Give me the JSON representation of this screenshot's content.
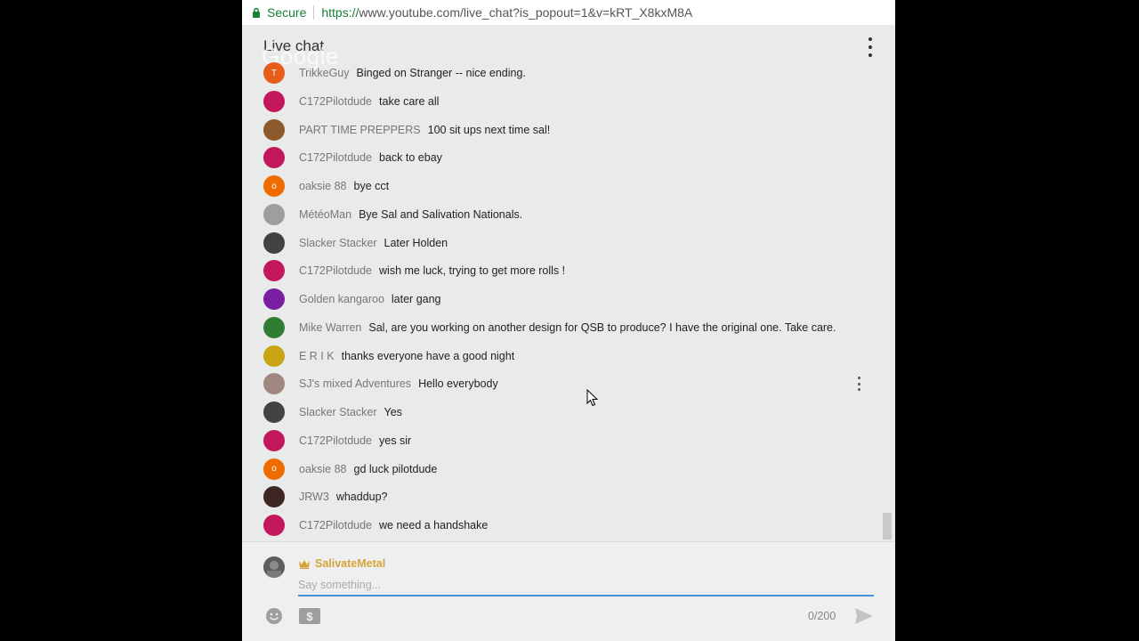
{
  "browser": {
    "secure_label": "Secure",
    "url_scheme": "https://",
    "url_rest": "www.youtube.com/live_chat?is_popout=1&v=kRT_X8kxM8A"
  },
  "header": {
    "title": "Live chat",
    "watermark": "Google",
    "menu_icon": "more-vert-icon"
  },
  "messages": [
    {
      "author": "TrikkeGuy",
      "text": "Binged on Stranger -- nice ending.",
      "avatar_color": "#e65c1a",
      "avatar_letter": "T"
    },
    {
      "author": "C172Pilotdude",
      "text": "take care all",
      "avatar_color": "#c2185b",
      "avatar_letter": ""
    },
    {
      "author": "PART TIME PREPPERS",
      "text": "100 sit ups next time sal!",
      "avatar_color": "#8d5a2b",
      "avatar_letter": ""
    },
    {
      "author": "C172Pilotdude",
      "text": "back to ebay",
      "avatar_color": "#c2185b",
      "avatar_letter": ""
    },
    {
      "author": "oaksie 88",
      "text": "bye cct",
      "avatar_color": "#ef6c00",
      "avatar_letter": "o"
    },
    {
      "author": "MétéoMan",
      "text": "Bye Sal and Salivation Nationals.",
      "avatar_color": "#9e9e9e",
      "avatar_letter": ""
    },
    {
      "author": "Slacker Stacker",
      "text": "Later Holden",
      "avatar_color": "#424242",
      "avatar_letter": ""
    },
    {
      "author": "C172Pilotdude",
      "text": "wish me luck, trying to get more rolls !",
      "avatar_color": "#c2185b",
      "avatar_letter": ""
    },
    {
      "author": "Golden kangaroo",
      "text": "later gang",
      "avatar_color": "#7b1fa2",
      "avatar_letter": ""
    },
    {
      "author": "Mike Warren",
      "text": "Sal, are you working on another design for QSB to produce? I have the original one. Take care.",
      "avatar_color": "#2e7d32",
      "avatar_letter": ""
    },
    {
      "author": "E R I K",
      "text": "thanks everyone have a good night",
      "avatar_color": "#c8a415",
      "avatar_letter": ""
    },
    {
      "author": "SJ's mixed Adventures",
      "text": "Hello everybody",
      "avatar_color": "#a1887f",
      "avatar_letter": ""
    },
    {
      "author": "Slacker Stacker",
      "text": "Yes",
      "avatar_color": "#424242",
      "avatar_letter": ""
    },
    {
      "author": "C172Pilotdude",
      "text": "yes sir",
      "avatar_color": "#c2185b",
      "avatar_letter": ""
    },
    {
      "author": "oaksie 88",
      "text": "gd luck pilotdude",
      "avatar_color": "#ef6c00",
      "avatar_letter": "o"
    },
    {
      "author": "JRW3",
      "text": "whaddup?",
      "avatar_color": "#3e2723",
      "avatar_letter": ""
    },
    {
      "author": "C172Pilotdude",
      "text": "we need a handshake",
      "avatar_color": "#c2185b",
      "avatar_letter": ""
    }
  ],
  "input": {
    "user_name": "SalivateMetal",
    "placeholder": "Say something...",
    "value": "",
    "counter": "0/200",
    "owner_color": "#d4a43a",
    "focus_color": "#4a90d9"
  }
}
